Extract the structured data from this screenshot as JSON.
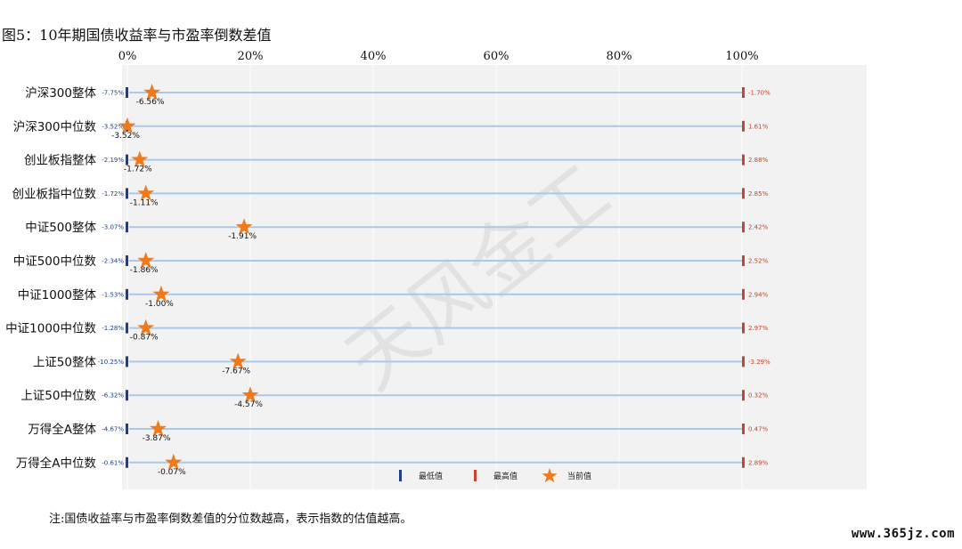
{
  "title": "图5：10年期国债收益率与市盈率倒数差值",
  "note": "注:国债收益率与市盈率倒数差值的分位数越高，表示指数的估值越高。",
  "site": "www.365jz.com",
  "watermark": "天风金工",
  "colors": {
    "min": "#1f3f8a",
    "max": "#c8442c",
    "current": "#f07a1a",
    "line": "#a9c8ea",
    "panel": "#f2f2f2"
  },
  "chart_data": {
    "type": "scatter",
    "title": "图5：10年期国债收益率与市盈率倒数差值",
    "x_ticks": [
      "0%",
      "20%",
      "40%",
      "60%",
      "80%",
      "100%"
    ],
    "xlim": [
      0,
      100
    ],
    "grid": true,
    "legend": {
      "placement": "bottom-center",
      "items": [
        "最低值",
        "最高值",
        "当前值"
      ]
    },
    "rows": [
      {
        "name": "沪深300整体",
        "min_label": "-7.75%",
        "max_label": "-1.70%",
        "current_label": "-6.56%",
        "percentile": 4
      },
      {
        "name": "沪深300中位数",
        "min_label": "-3.52%",
        "max_label": "1.61%",
        "current_label": "-3.52%",
        "percentile": 0
      },
      {
        "name": "创业板指整体",
        "min_label": "-2.19%",
        "max_label": "2.88%",
        "current_label": "-1.72%",
        "percentile": 2
      },
      {
        "name": "创业板指中位数",
        "min_label": "-1.72%",
        "max_label": "2.85%",
        "current_label": "-1.11%",
        "percentile": 3
      },
      {
        "name": "中证500整体",
        "min_label": "-3.07%",
        "max_label": "2.42%",
        "current_label": "-1.91%",
        "percentile": 19
      },
      {
        "name": "中证500中位数",
        "min_label": "-2.34%",
        "max_label": "2.52%",
        "current_label": "-1.86%",
        "percentile": 3
      },
      {
        "name": "中证1000整体",
        "min_label": "-1.53%",
        "max_label": "2.94%",
        "current_label": "-1.00%",
        "percentile": 5.5
      },
      {
        "name": "中证1000中位数",
        "min_label": "-1.28%",
        "max_label": "2.97%",
        "current_label": "-0.87%",
        "percentile": 3
      },
      {
        "name": "上证50整体",
        "min_label": "-10.25%",
        "max_label": "-3.29%",
        "current_label": "-7.67%",
        "percentile": 18
      },
      {
        "name": "上证50中位数",
        "min_label": "-6.32%",
        "max_label": "0.32%",
        "current_label": "-4.57%",
        "percentile": 20
      },
      {
        "name": "万得全A整体",
        "min_label": "-4.67%",
        "max_label": "0.47%",
        "current_label": "-3.87%",
        "percentile": 5
      },
      {
        "name": "万得全A中位数",
        "min_label": "-0.61%",
        "max_label": "2.89%",
        "current_label": "-0.07%",
        "percentile": 7.5
      }
    ]
  }
}
